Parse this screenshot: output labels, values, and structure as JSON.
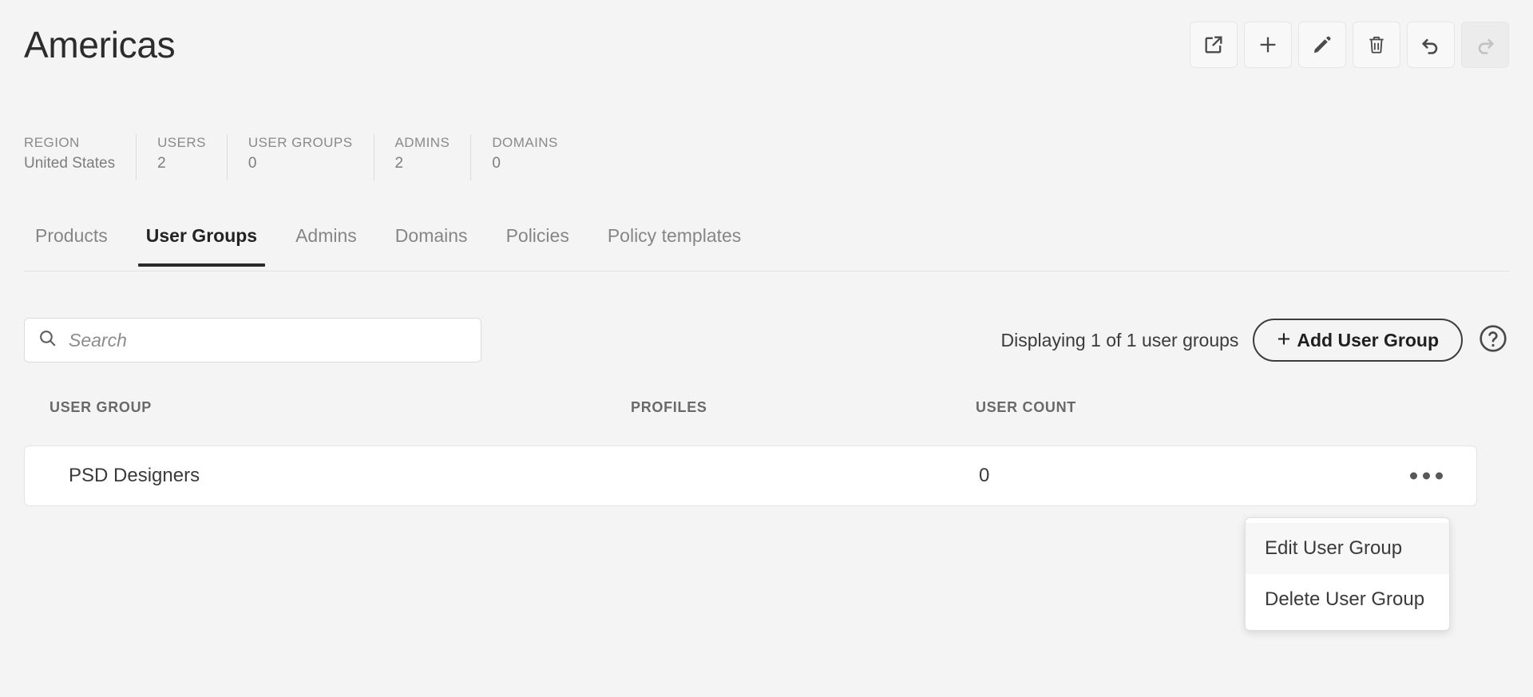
{
  "header": {
    "title": "Americas",
    "toolbar": [
      {
        "name": "export-icon",
        "label": "Export",
        "disabled": false
      },
      {
        "name": "add-icon",
        "label": "Add",
        "disabled": false
      },
      {
        "name": "edit-pencil-icon",
        "label": "Edit",
        "disabled": false
      },
      {
        "name": "trash-icon",
        "label": "Delete",
        "disabled": false
      },
      {
        "name": "undo-icon",
        "label": "Undo",
        "disabled": false
      },
      {
        "name": "redo-icon",
        "label": "Redo",
        "disabled": true
      }
    ]
  },
  "stats": [
    {
      "label": "REGION",
      "value": "United States"
    },
    {
      "label": "USERS",
      "value": "2"
    },
    {
      "label": "USER GROUPS",
      "value": "0"
    },
    {
      "label": "ADMINS",
      "value": "2"
    },
    {
      "label": "DOMAINS",
      "value": "0"
    }
  ],
  "tabs": [
    {
      "label": "Products",
      "active": false
    },
    {
      "label": "User Groups",
      "active": true
    },
    {
      "label": "Admins",
      "active": false
    },
    {
      "label": "Domains",
      "active": false
    },
    {
      "label": "Policies",
      "active": false
    },
    {
      "label": "Policy templates",
      "active": false
    }
  ],
  "controls": {
    "search_placeholder": "Search",
    "search_value": "",
    "displaying_text": "Displaying 1 of 1 user groups",
    "add_button_label": "Add User Group",
    "add_button_plus": "+",
    "help_icon": "question-mark-circle-icon"
  },
  "table": {
    "columns": [
      "USER GROUP",
      "PROFILES",
      "USER COUNT"
    ],
    "rows": [
      {
        "user_group": "PSD Designers",
        "profiles": "",
        "user_count": "0"
      }
    ]
  },
  "popup_menu": {
    "items": [
      {
        "label": "Edit User Group",
        "hovered": true
      },
      {
        "label": "Delete User Group",
        "hovered": false
      }
    ]
  },
  "colors": {
    "page_background": "#f4f4f4",
    "card_background": "#ffffff",
    "text_primary": "#2c2c2c",
    "text_muted": "#8a8a8a",
    "active_tab_underline": "#2b2b2b",
    "border": "#e2e2e2"
  }
}
